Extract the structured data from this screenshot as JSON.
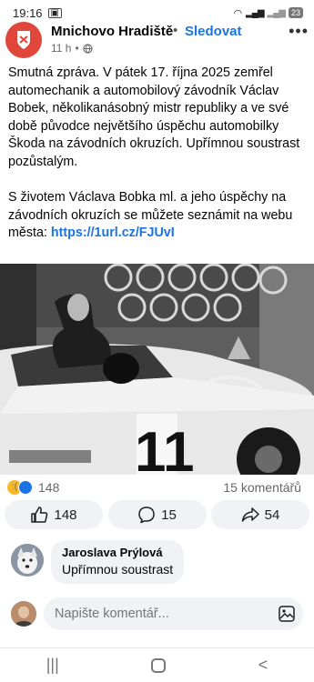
{
  "status": {
    "time": "19:16",
    "battery": "23"
  },
  "post": {
    "page_name": "Mnichovo Hradiště",
    "separator": "•",
    "follow_label": "Sledovat",
    "age": "11 h",
    "paragraph1": "Smutná zpráva. V pátek 17. října 2025 zemřel automechanik a automobilový závodník Václav Bobek, několikanásobný mistr republiky a ve své době původce největšího úspěchu automobilky Škoda na závodních okruzích. Upřímnou soustrast pozůstalým.",
    "paragraph2": "S životem Václava Bobka ml. a jeho úspěchy na závodních okruzích se můžete seznámit na webu města: ",
    "link": "https://1url.cz/FJUvI",
    "photo_car_number": "11"
  },
  "engagement": {
    "reaction_count": "148",
    "comments_label": "15 komentářů",
    "like_count": "148",
    "comment_count": "15",
    "share_count": "54"
  },
  "comment": {
    "author": "Jaroslava Prýlová",
    "text": "Upřímnou soustrast"
  },
  "composer": {
    "placeholder": "Napište komentář..."
  },
  "icons": {
    "avatar": "page-logo-icon",
    "globe": "globe-icon",
    "more": "more-options-icon",
    "like": "thumb-up-icon",
    "comment": "comment-icon",
    "share": "share-icon",
    "image": "image-icon"
  }
}
